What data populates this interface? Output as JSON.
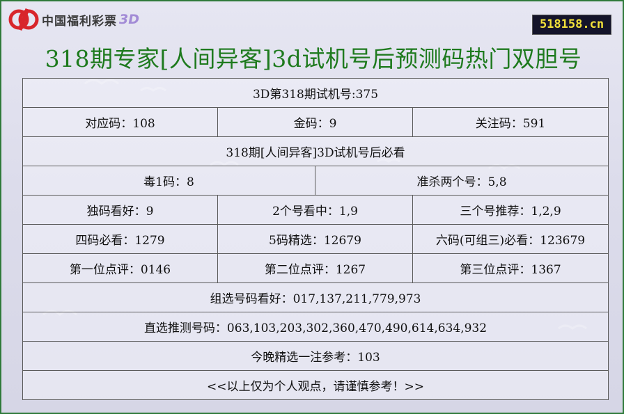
{
  "logo": {
    "brand_text": "中国福利彩票",
    "brand_suffix": "3D",
    "mark_color": "#d8252b"
  },
  "site_badge": "518158.cn",
  "title": "318期专家[人间异客]3d试机号后预测码热门双胆号",
  "colors": {
    "title": "#1e7a1e",
    "frame": "#2f7a3a",
    "badge_bg": "#14142a",
    "badge_text": "#f3e23a"
  },
  "table": {
    "test_number": "3D第318期试机号:375",
    "row2": [
      "对应码：108",
      "金码：9",
      "关注码：591"
    ],
    "must_see": "318期[人间异客]3D试机号后必看",
    "row4": [
      "毒1码：8",
      "准杀两个号：5,8"
    ],
    "row5": [
      "独码看好：9",
      "2个号看中：1,9",
      "三个号推荐：1,2,9"
    ],
    "row6": [
      "四码必看：1279",
      "5码精选：12679",
      "六码(可组三)必看：123679"
    ],
    "row7": [
      "第一位点评：0146",
      "第二位点评：1267",
      "第三位点评：1367"
    ],
    "group_pick": "组选号码看好：017,137,211,779,973",
    "direct_pick": "直选推测号码：063,103,203,302,360,470,490,614,634,932",
    "tonight_pick": "今晚精选一注参考：103",
    "disclaimer": "<<以上仅为个人观点，请谨慎参考！>>"
  }
}
